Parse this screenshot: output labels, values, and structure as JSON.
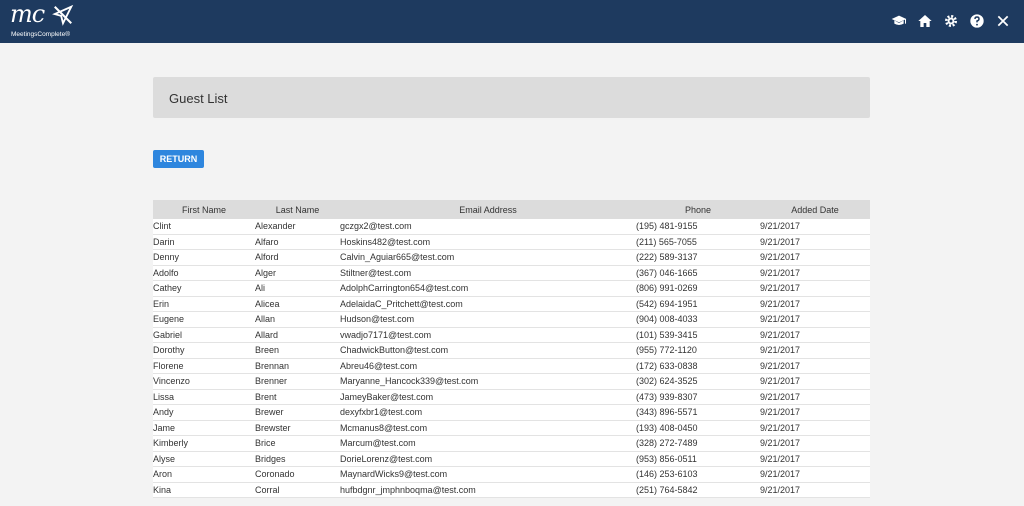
{
  "app": {
    "logo_text": "mc",
    "logo_subtext": "MeetingsComplete®"
  },
  "header_icons": [
    "graduation-cap-icon",
    "home-icon",
    "gear-icon",
    "help-icon",
    "close-icon"
  ],
  "page": {
    "title": "Guest List",
    "return_label": "RETURN"
  },
  "table": {
    "headers": [
      "First Name",
      "Last Name",
      "Email Address",
      "Phone",
      "Added Date"
    ],
    "rows": [
      [
        "Clint",
        "Alexander",
        "gczgx2@test.com",
        "(195) 481-9155",
        "9/21/2017"
      ],
      [
        "Darin",
        "Alfaro",
        "Hoskins482@test.com",
        "(211) 565-7055",
        "9/21/2017"
      ],
      [
        "Denny",
        "Alford",
        "Calvin_Aguiar665@test.com",
        "(222) 589-3137",
        "9/21/2017"
      ],
      [
        "Adolfo",
        "Alger",
        "Stiltner@test.com",
        "(367) 046-1665",
        "9/21/2017"
      ],
      [
        "Cathey",
        "Ali",
        "AdolphCarrington654@test.com",
        "(806) 991-0269",
        "9/21/2017"
      ],
      [
        "Erin",
        "Alicea",
        "AdelaidaC_Pritchett@test.com",
        "(542) 694-1951",
        "9/21/2017"
      ],
      [
        "Eugene",
        "Allan",
        "Hudson@test.com",
        "(904) 008-4033",
        "9/21/2017"
      ],
      [
        "Gabriel",
        "Allard",
        "vwadjo7171@test.com",
        "(101) 539-3415",
        "9/21/2017"
      ],
      [
        "Dorothy",
        "Breen",
        "ChadwickButton@test.com",
        "(955) 772-1120",
        "9/21/2017"
      ],
      [
        "Florene",
        "Brennan",
        "Abreu46@test.com",
        "(172) 633-0838",
        "9/21/2017"
      ],
      [
        "Vincenzo",
        "Brenner",
        "Maryanne_Hancock339@test.com",
        "(302) 624-3525",
        "9/21/2017"
      ],
      [
        "Lissa",
        "Brent",
        "JameyBaker@test.com",
        "(473) 939-8307",
        "9/21/2017"
      ],
      [
        "Andy",
        "Brewer",
        "dexyfxbr1@test.com",
        "(343) 896-5571",
        "9/21/2017"
      ],
      [
        "Jame",
        "Brewster",
        "Mcmanus8@test.com",
        "(193) 408-0450",
        "9/21/2017"
      ],
      [
        "Kimberly",
        "Brice",
        "Marcum@test.com",
        "(328) 272-7489",
        "9/21/2017"
      ],
      [
        "Alyse",
        "Bridges",
        "DorieLorenz@test.com",
        "(953) 856-0511",
        "9/21/2017"
      ],
      [
        "Aron",
        "Coronado",
        "MaynardWicks9@test.com",
        "(146) 253-6103",
        "9/21/2017"
      ],
      [
        "Kina",
        "Corral",
        "hufbdgnr_jmphnboqma@test.com",
        "(251) 764-5842",
        "9/21/2017"
      ]
    ]
  }
}
